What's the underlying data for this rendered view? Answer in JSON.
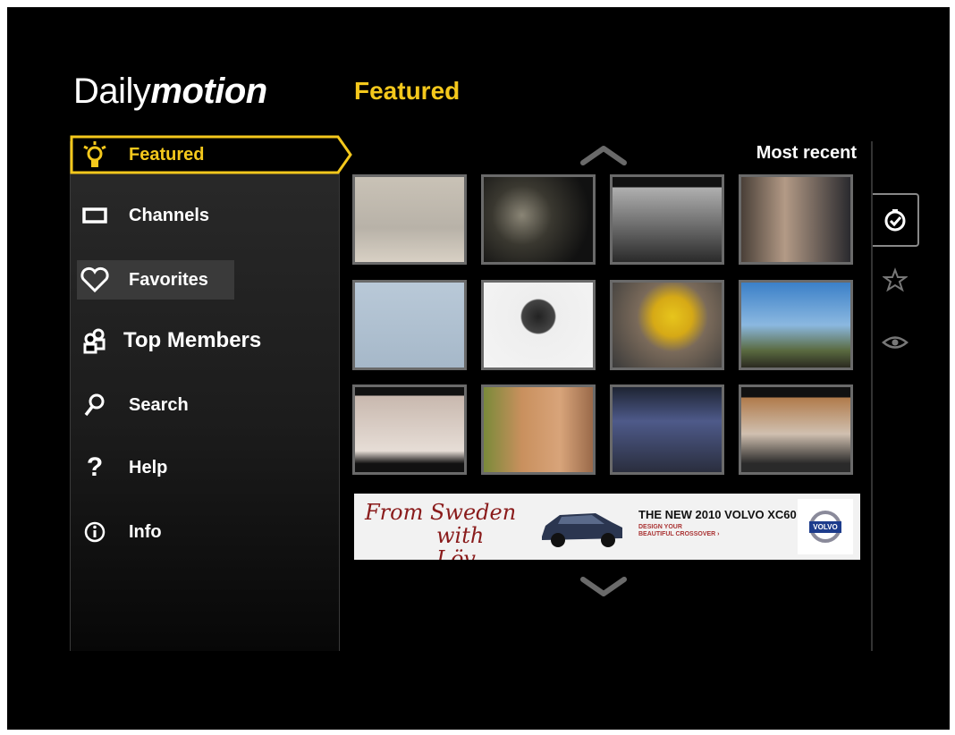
{
  "logo": {
    "light": "Daily",
    "bold": "motion"
  },
  "page_title": "Featured",
  "sidebar": {
    "items": [
      {
        "label": "Featured",
        "icon": "lightbulb-icon",
        "selected": true
      },
      {
        "label": "Channels",
        "icon": "tv-rectangle-icon"
      },
      {
        "label": "Favorites",
        "icon": "heart-icon"
      },
      {
        "label": "Top Members",
        "icon": "members-icon"
      },
      {
        "label": "Search",
        "icon": "search-icon"
      },
      {
        "label": "Help",
        "icon": "question-mark-icon"
      },
      {
        "label": "Info",
        "icon": "info-icon"
      }
    ]
  },
  "sort_label": "Most recent",
  "filter_tabs": [
    {
      "icon": "clock-check-icon",
      "selected": true
    },
    {
      "icon": "star-icon"
    },
    {
      "icon": "eye-icon"
    }
  ],
  "ad": {
    "script_line1": "From Sweden",
    "script_line2": "with Löv",
    "headline": "THE NEW 2010 VOLVO XC60",
    "sub1": "DESIGN YOUR",
    "sub2": "BEAUTIFUL CROSSOVER ›",
    "logo_text": "VOLVO"
  },
  "colors": {
    "accent": "#f4c81c",
    "background": "#000000"
  }
}
